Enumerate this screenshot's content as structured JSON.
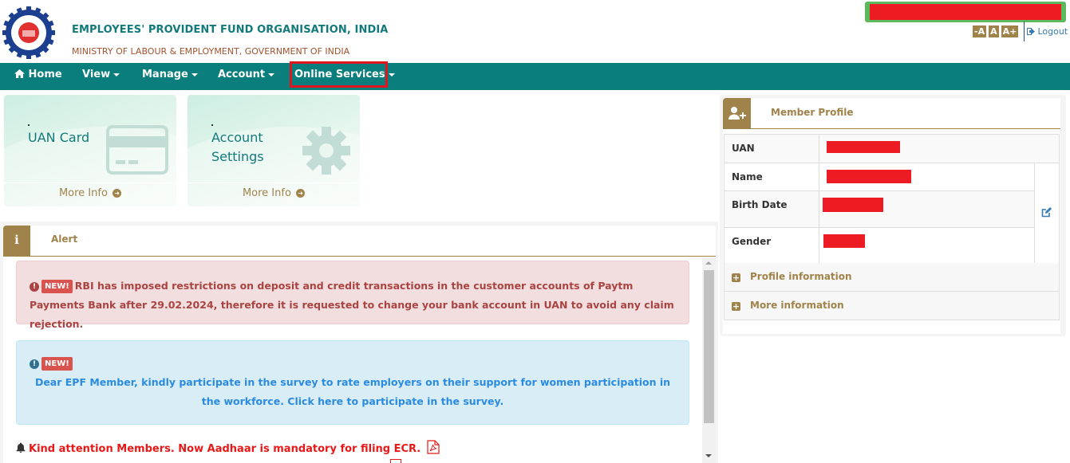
{
  "header": {
    "org_title": "EMPLOYEES' PROVIDENT FUND ORGANISATION, INDIA",
    "org_subtitle": "MINISTRY OF LABOUR & EMPLOYMENT, GOVERNMENT OF INDIA",
    "logo_icon": "epfo-emblem-icon",
    "user_name": "[redacted]",
    "font_controls": [
      "-A",
      "A",
      "A+"
    ],
    "logout_label": "Logout",
    "logout_icon": "sign-out-icon"
  },
  "nav": {
    "items": [
      {
        "label": "Home",
        "icon": "home-icon",
        "dropdown": false
      },
      {
        "label": "View",
        "dropdown": true
      },
      {
        "label": "Manage",
        "dropdown": true
      },
      {
        "label": "Account",
        "dropdown": true
      },
      {
        "label": "Online Services",
        "dropdown": true,
        "highlighted": true
      }
    ]
  },
  "tiles": [
    {
      "title_line1": "UAN Card",
      "title_line2": "",
      "icon": "credit-card-icon",
      "footer": "More Info"
    },
    {
      "title_line1": "Account",
      "title_line2": "Settings",
      "icon": "gear-icon",
      "footer": "More Info"
    }
  ],
  "alert_panel": {
    "title": "Alert",
    "icon": "info-icon",
    "badge": "NEW!",
    "danger_text": "RBI has imposed restrictions on deposit and credit transactions in the customer accounts of Paytm Payments Bank after 29.02.2024, therefore it is requested to change your bank account in UAN to avoid any claim rejection.",
    "info_text": "Dear EPF Member, kindly participate in the survey to rate employers on their support for women participation in the workforce. Click here to participate in the survey.",
    "notice_text": "Kind attention Members. Now Aadhaar is mandatory for filing ECR."
  },
  "profile": {
    "title": "Member Profile",
    "icon": "user-plus-icon",
    "rows": [
      {
        "label": "UAN",
        "value": "[redacted]"
      },
      {
        "label": "Name",
        "value": "[redacted]"
      },
      {
        "label": "Birth Date",
        "value": "[redacted]"
      },
      {
        "label": "Gender",
        "value": "[redacted]"
      }
    ],
    "edit_icon": "edit-icon",
    "accordions": [
      "Profile information",
      "More information"
    ]
  },
  "colors": {
    "brand_teal": "#0a7d7d",
    "title_teal": "#137a7a",
    "accent_gold": "#a0834a",
    "danger_text": "#a94442",
    "info_text": "#2a8be0",
    "notice_red": "#e81818",
    "highlight_red": "#e0161e",
    "user_box_green": "#5cb85c"
  }
}
